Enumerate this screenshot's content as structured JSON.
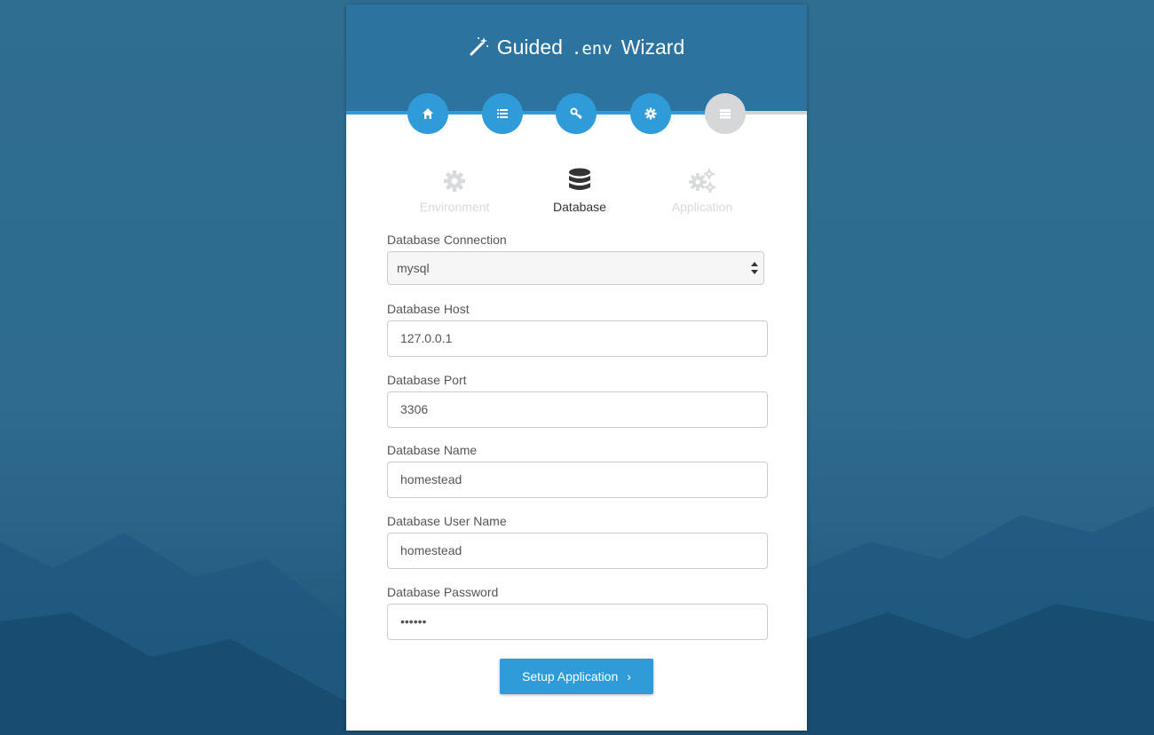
{
  "header": {
    "title_part1": "Guided",
    "title_mono": ".env",
    "title_part2": "Wizard",
    "wand_icon": "magic-wand-icon"
  },
  "steps": [
    {
      "icon": "home-icon",
      "state": "complete"
    },
    {
      "icon": "list-icon",
      "state": "complete"
    },
    {
      "icon": "key-icon",
      "state": "complete"
    },
    {
      "icon": "gear-icon",
      "state": "complete"
    },
    {
      "icon": "server-icon",
      "state": "current"
    }
  ],
  "progress_fraction": 0.82,
  "tabs": [
    {
      "label": "Environment",
      "icon": "cog-icon",
      "active": false
    },
    {
      "label": "Database",
      "icon": "database-icon",
      "active": true
    },
    {
      "label": "Application",
      "icon": "cogs-icon",
      "active": false
    }
  ],
  "form": {
    "connection": {
      "label": "Database Connection",
      "value": "mysql"
    },
    "host": {
      "label": "Database Host",
      "value": "127.0.0.1"
    },
    "port": {
      "label": "Database Port",
      "value": "3306"
    },
    "name": {
      "label": "Database Name",
      "value": "homestead"
    },
    "user": {
      "label": "Database User Name",
      "value": "homestead"
    },
    "password": {
      "label": "Database Password",
      "value": "••••••"
    }
  },
  "submit": {
    "label": "Setup Application",
    "chevron": "›"
  },
  "colors": {
    "accent": "#2f9bd9",
    "header": "#2c73a0",
    "inactive": "#d5d7d9",
    "background": "#2f6d91"
  }
}
